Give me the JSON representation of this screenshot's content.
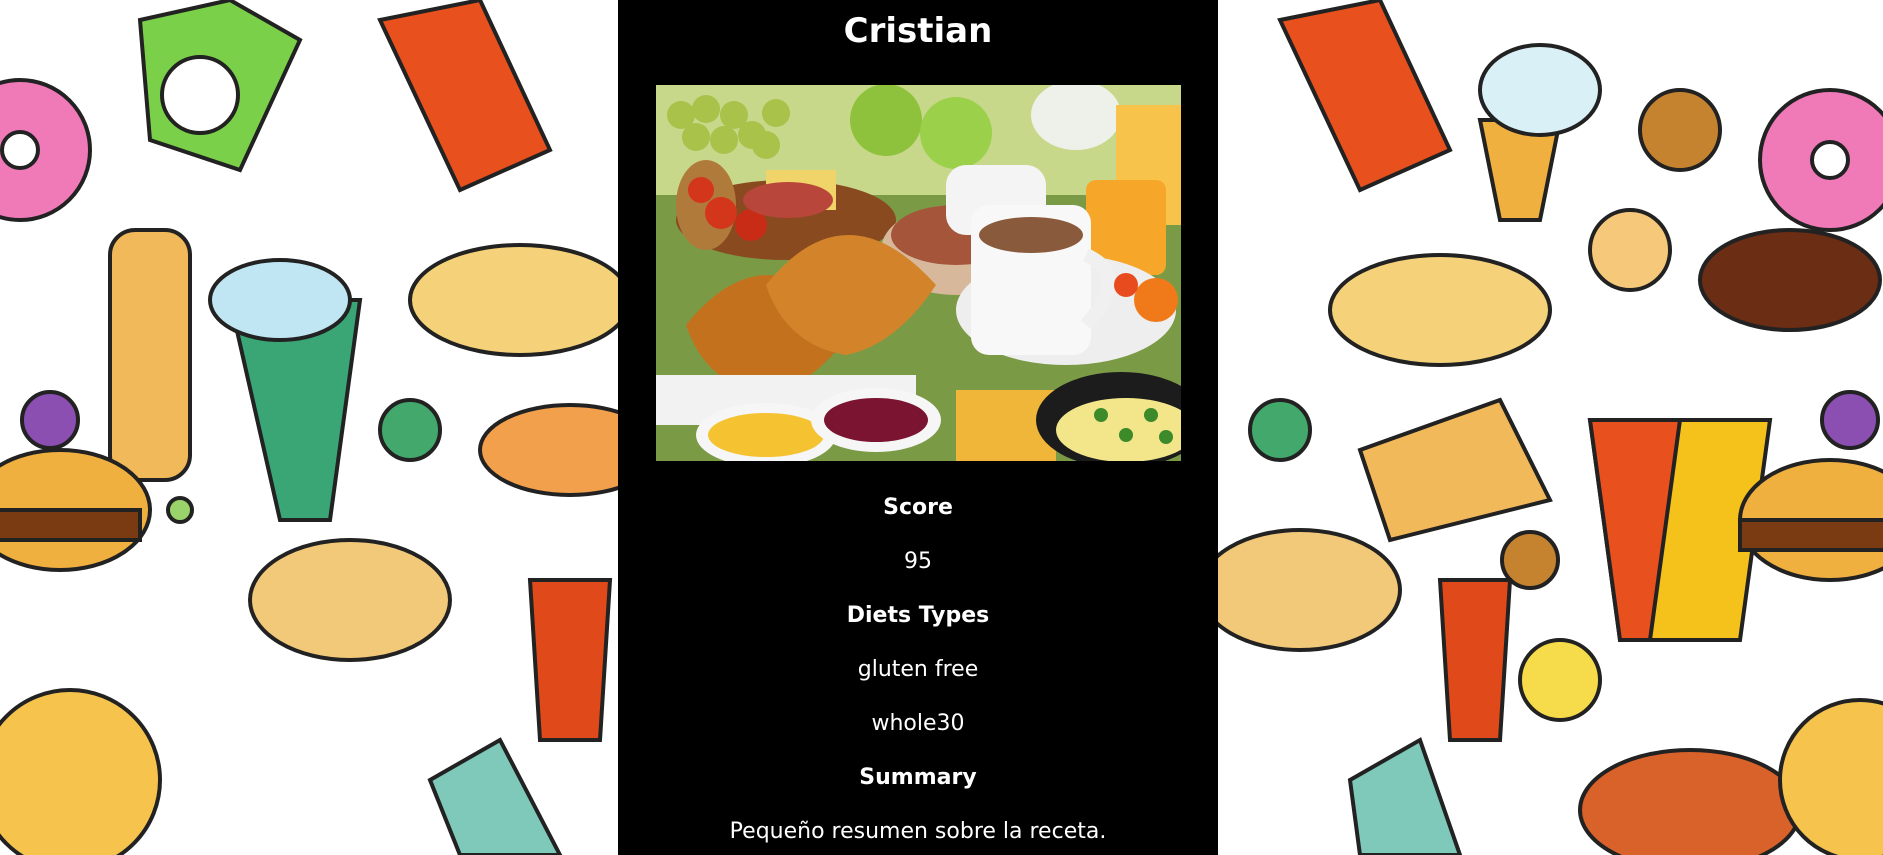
{
  "recipe": {
    "name": "Cristian",
    "image_alt": "Breakfast table with croissants, coffee, orange juice, fruit, cereal, jam and scrambled eggs",
    "score_heading": "Score",
    "score_value": "95",
    "diets_heading": "Diets Types",
    "diets": [
      "gluten free",
      "whole30"
    ],
    "summary_heading": "Summary",
    "summary_text": "Pequeño resumen sobre la receta."
  },
  "colors": {
    "card_background": "#000000",
    "card_text": "#ffffff",
    "page_background": "#ffffff"
  }
}
